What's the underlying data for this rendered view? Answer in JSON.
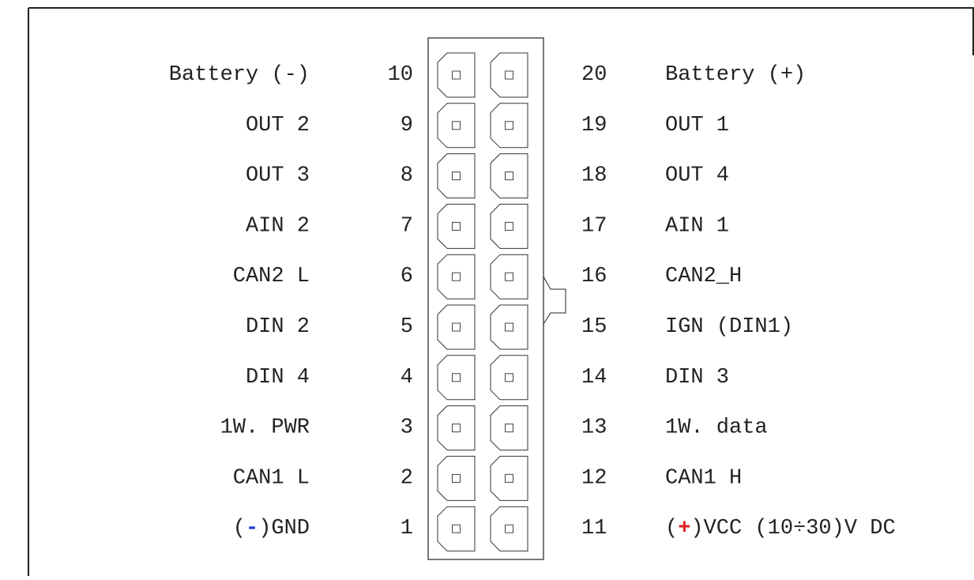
{
  "diagram": {
    "title": "",
    "colors": {
      "line": "#222222",
      "minus_sign": "#1f3fd0",
      "plus_sign": "#e0201e"
    },
    "left_pins": [
      {
        "number": "10",
        "label": "Battery (-)"
      },
      {
        "number": "9",
        "label": "OUT 2"
      },
      {
        "number": "8",
        "label": "OUT 3"
      },
      {
        "number": "7",
        "label": "AIN 2"
      },
      {
        "number": "6",
        "label": "CAN2 L"
      },
      {
        "number": "5",
        "label": "DIN 2"
      },
      {
        "number": "4",
        "label": "DIN 4"
      },
      {
        "number": "3",
        "label": "1W. PWR"
      },
      {
        "number": "2",
        "label": "CAN1 L"
      },
      {
        "number": "1",
        "label": "GND",
        "sign": "-"
      }
    ],
    "right_pins": [
      {
        "number": "20",
        "label": "Battery (+)"
      },
      {
        "number": "19",
        "label": "OUT 1"
      },
      {
        "number": "18",
        "label": "OUT 4"
      },
      {
        "number": "17",
        "label": "AIN 1"
      },
      {
        "number": "16",
        "label": "CAN2_H"
      },
      {
        "number": "15",
        "label": "IGN (DIN1)"
      },
      {
        "number": "14",
        "label": "DIN 3"
      },
      {
        "number": "13",
        "label": "1W. data"
      },
      {
        "number": "12",
        "label": "CAN1 H"
      },
      {
        "number": "11",
        "label": "VCC (10÷30)V DC",
        "sign": "+"
      }
    ]
  }
}
